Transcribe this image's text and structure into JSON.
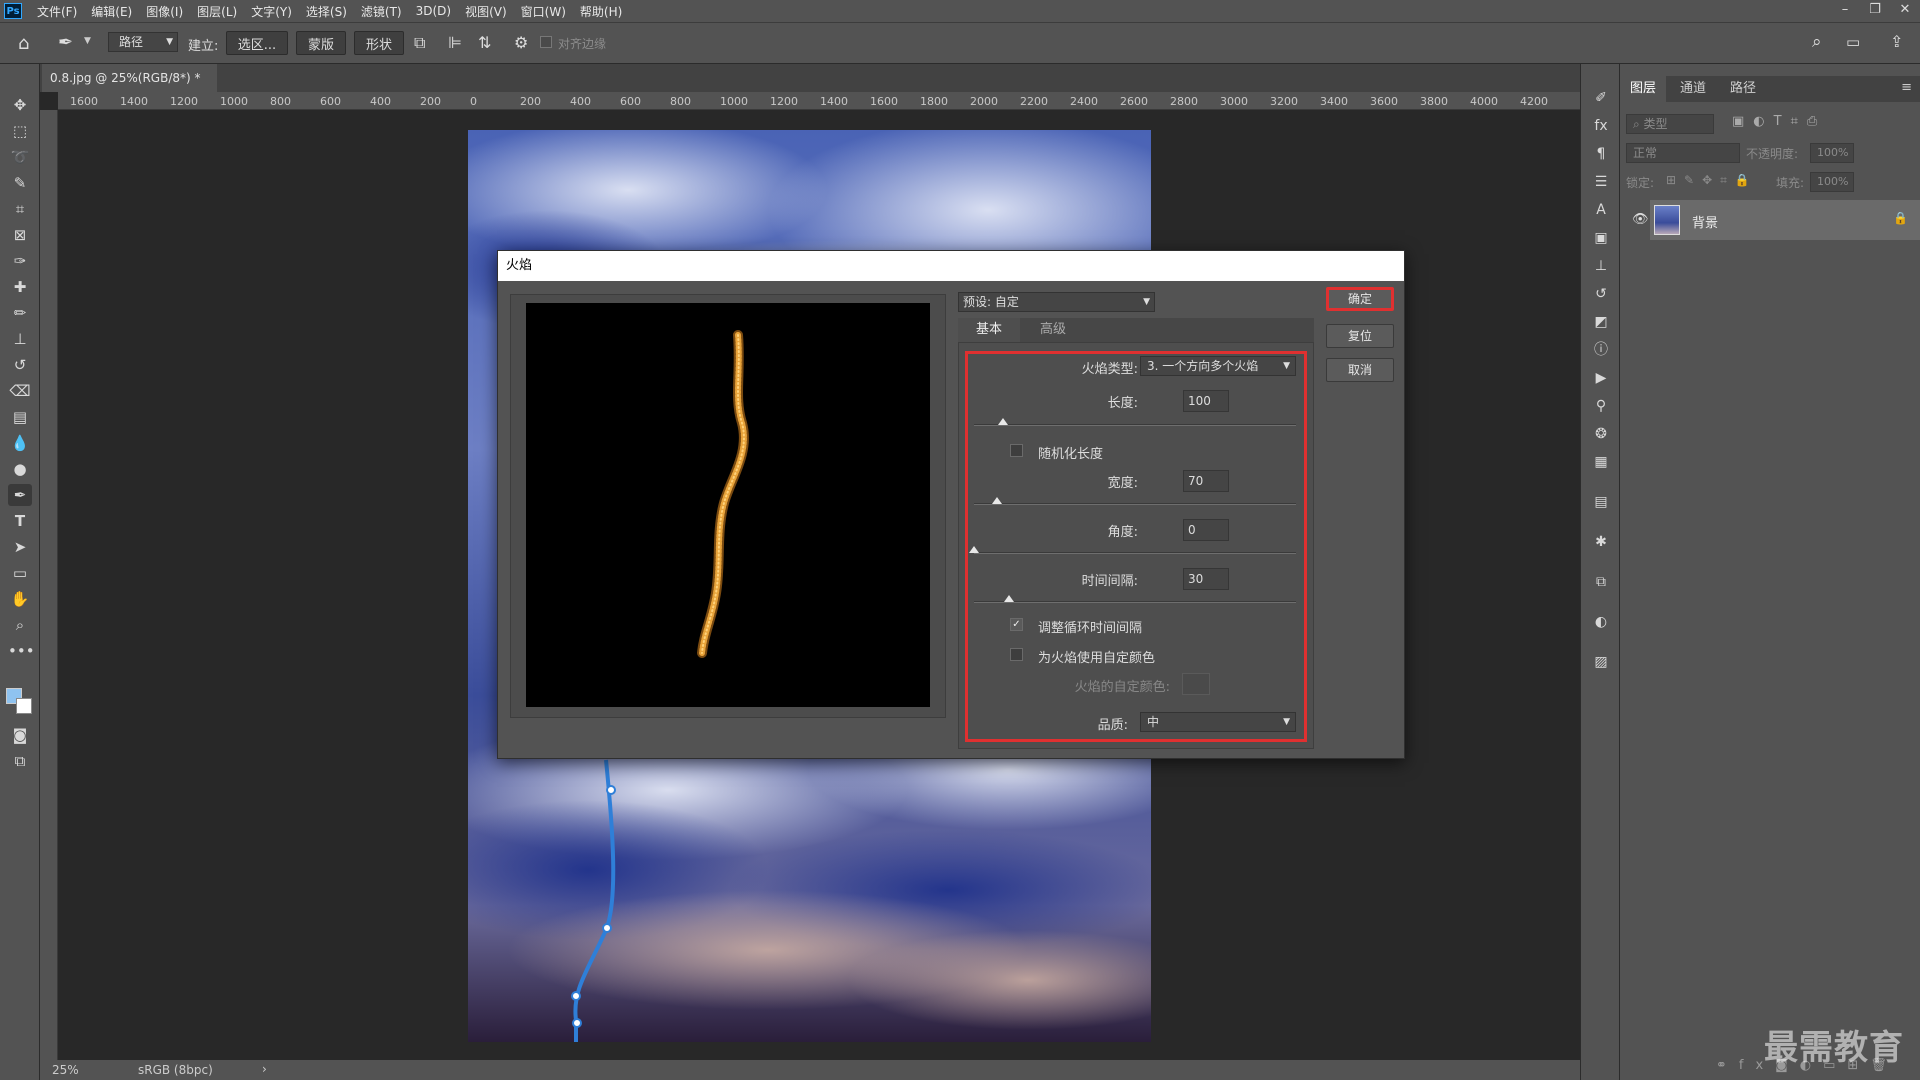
{
  "menubar": {
    "logo": "Ps",
    "items": [
      "文件(F)",
      "编辑(E)",
      "图像(I)",
      "图层(L)",
      "文字(Y)",
      "选择(S)",
      "滤镜(T)",
      "3D(D)",
      "视图(V)",
      "窗口(W)",
      "帮助(H)"
    ]
  },
  "options": {
    "mode_select": "路径",
    "make_label": "建立:",
    "selection_btn": "选区...",
    "mask_btn": "蒙版",
    "shape_btn": "形状",
    "align_edges": "对齐边缘"
  },
  "document": {
    "tab_title": "0.8.jpg @ 25%(RGB/8*) *",
    "ruler_labels": [
      "1600",
      "1400",
      "1200",
      "1000",
      "800",
      "600",
      "400",
      "200",
      "0",
      "200",
      "400",
      "600",
      "800",
      "1000",
      "1200",
      "1400",
      "1600",
      "1800",
      "2000",
      "2200",
      "2400",
      "2600",
      "2800",
      "3000",
      "3200",
      "3400",
      "3600",
      "3800",
      "4000",
      "4200"
    ],
    "zoom": "25%",
    "color_profile": "sRGB (8bpc)"
  },
  "layers_panel": {
    "tabs": [
      "图层",
      "通道",
      "路径"
    ],
    "filter_placeholder": "类型",
    "blend_mode": "正常",
    "opacity_label": "不透明度:",
    "opacity_value": "100%",
    "lock_label": "锁定:",
    "fill_label": "填充:",
    "fill_value": "100%",
    "layer_name": "背景"
  },
  "dialog": {
    "title": "火焰",
    "preset_label": "预设: 自定",
    "tabs": [
      "基本",
      "高级"
    ],
    "ok": "确定",
    "reset": "复位",
    "cancel": "取消",
    "flame_type_label": "火焰类型:",
    "flame_type_value": "3. 一个方向多个火焰",
    "length_label": "长度:",
    "length_value": "100",
    "length_pos": 0.09,
    "randomize_length": "随机化长度",
    "randomize_checked": false,
    "width_label": "宽度:",
    "width_value": "70",
    "width_pos": 0.07,
    "angle_label": "角度:",
    "angle_value": "0",
    "angle_pos": 0.0,
    "interval_label": "时间间隔:",
    "interval_value": "30",
    "interval_pos": 0.11,
    "adjust_loop": "调整循环时间间隔",
    "adjust_loop_checked": true,
    "custom_color": "为火焰使用自定颜色",
    "custom_color_checked": false,
    "custom_color_label": "火焰的自定颜色:",
    "quality_label": "品质:",
    "quality_value": "中"
  },
  "watermark": "最需教育",
  "colors": {
    "accent_red": "#e03030",
    "path_blue": "#2f7fd8",
    "flame": "#e8a33a"
  }
}
